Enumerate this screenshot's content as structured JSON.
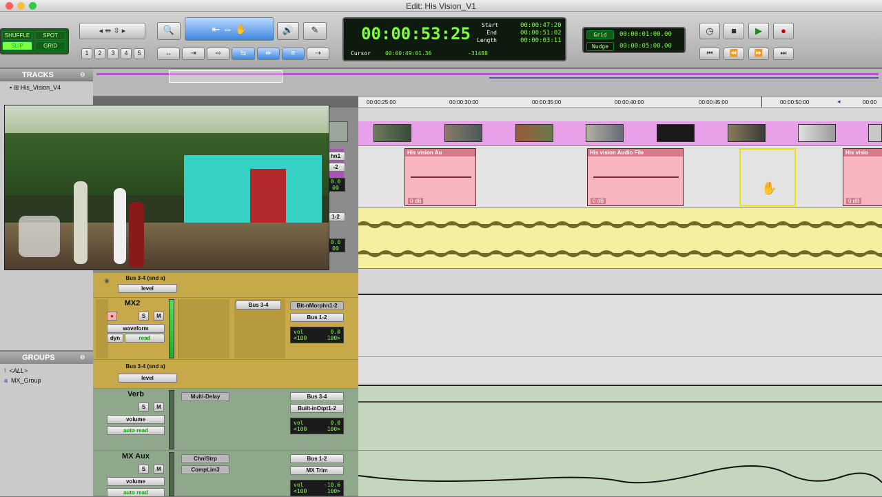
{
  "window": {
    "title": "Edit: His Vision_V1"
  },
  "toolbar": {
    "edit_modes": [
      "SHUFFLE",
      "SPOT",
      "SLIP",
      "GRID"
    ],
    "zoom_presets": [
      "1",
      "2",
      "3",
      "4",
      "5"
    ],
    "counter": {
      "main": "00:00:53:25",
      "start_label": "Start",
      "start": "00:00:47:20",
      "end_label": "End",
      "end": "00:00:51:02",
      "length_label": "Length",
      "length": "00:00:03:11",
      "cursor_label": "Cursor",
      "cursor": "00:00:49:01.36",
      "sample": "-31488"
    },
    "grid": {
      "label": "Grid",
      "value": "00:00:01:00.00"
    },
    "nudge": {
      "label": "Nudge",
      "value": "00:00:05:00.00"
    }
  },
  "tracks": {
    "header": "TRACKS",
    "items": [
      "His_Vision_V4"
    ]
  },
  "groups": {
    "header": "GROUPS",
    "items": [
      {
        "id": "!",
        "name": "<ALL>"
      },
      {
        "id": "a",
        "name": "MX_Group"
      }
    ]
  },
  "ruler": {
    "ticks": [
      "00:00:25:00",
      "00:00:30:00",
      "00:00:35:00",
      "00:00:40:00",
      "00:00:45:00",
      "00:00:50:00",
      "00:00"
    ]
  },
  "clips": [
    {
      "name": "His vision Au",
      "gain": "0 dB"
    },
    {
      "name": "His vision Audio File",
      "gain": "0 dB"
    },
    {
      "name": "His visio",
      "gain": "0 dB"
    }
  ],
  "video_side": {
    "vol1": "0.0",
    "vol1b": "00",
    "vol2": "0.0",
    "vol2b": "00",
    "io1": "hn1",
    "io1b": "-2",
    "io2": "1-2"
  },
  "mixer": {
    "aux_send1": {
      "bus": "Bus 3-4 (snd a)",
      "mode": "level"
    },
    "mx2": {
      "name": "MX2",
      "view": "waveform",
      "auto_label": "dyn",
      "auto": "read",
      "send": "Bus 3-4",
      "insert": "Bit-nMorphn1-2",
      "out": "Bus 1-2",
      "vol_label": "vol",
      "vol": "0.0",
      "pan": "<100",
      "pan2": "100>"
    },
    "aux_send2": {
      "bus": "Bus 3-4 (snd a)",
      "mode": "level"
    },
    "verb": {
      "name": "Verb",
      "view": "volume",
      "auto": "auto read",
      "insert": "Multi-Delay",
      "in": "Bus 3-4",
      "out": "Built-inOtpt1-2",
      "vol_label": "vol",
      "vol": "0.0",
      "pan": "<100",
      "pan2": "100>"
    },
    "mxaux": {
      "name": "MX Aux",
      "view": "volume",
      "auto": "auto read",
      "insert1": "ChnlStrp",
      "insert2": "CompLim3",
      "in": "Bus 1-2",
      "out": "MX Trim",
      "vol_label": "vol",
      "vol": "-10.6",
      "pan": "<100",
      "pan2": "100>"
    }
  },
  "colors": {
    "video": "#e8a0e8",
    "audio_clip": "#f6b5bf",
    "yellow_track": "#f4f0a0",
    "green_track": "#c5d6bf",
    "selection": "#f0e000"
  }
}
